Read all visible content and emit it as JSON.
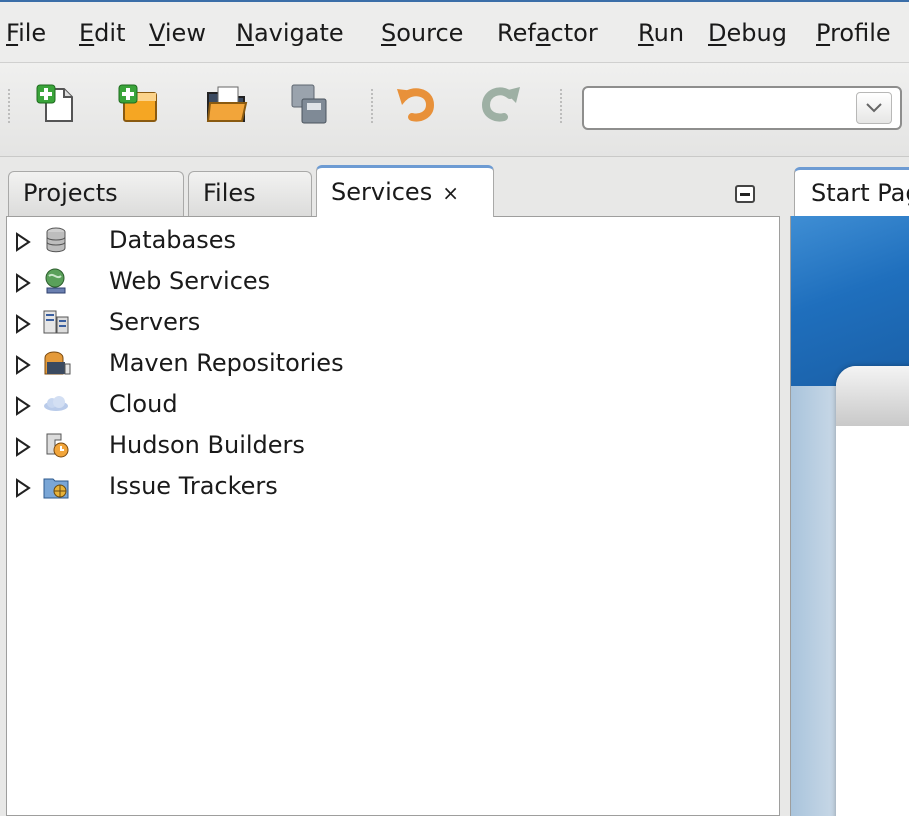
{
  "menubar": {
    "items": [
      {
        "pre": "",
        "u": "F",
        "post": "ile"
      },
      {
        "pre": "",
        "u": "E",
        "post": "dit"
      },
      {
        "pre": "",
        "u": "V",
        "post": "iew"
      },
      {
        "pre": "",
        "u": "N",
        "post": "avigate"
      },
      {
        "pre": "",
        "u": "S",
        "post": "ource"
      },
      {
        "pre": "Ref",
        "u": "a",
        "post": "ctor"
      },
      {
        "pre": "",
        "u": "R",
        "post": "un"
      },
      {
        "pre": "",
        "u": "D",
        "post": "ebug"
      },
      {
        "pre": "",
        "u": "P",
        "post": "rofile"
      }
    ]
  },
  "toolbar": {
    "icons": [
      "new-file-icon",
      "new-project-icon",
      "open-project-icon",
      "save-all-icon",
      "undo-icon",
      "redo-icon"
    ],
    "config_combo_value": ""
  },
  "left_panel": {
    "tabs": [
      {
        "label": "Projects"
      },
      {
        "label": "Files"
      },
      {
        "label": "Services",
        "close": "×"
      }
    ],
    "tree": [
      {
        "label": "Databases",
        "icon": "database-icon"
      },
      {
        "label": "Web Services",
        "icon": "web-services-icon"
      },
      {
        "label": "Servers",
        "icon": "servers-icon"
      },
      {
        "label": "Maven Repositories",
        "icon": "maven-icon"
      },
      {
        "label": "Cloud",
        "icon": "cloud-icon"
      },
      {
        "label": "Hudson Builders",
        "icon": "hudson-icon"
      },
      {
        "label": "Issue Trackers",
        "icon": "issue-tracker-icon"
      }
    ]
  },
  "right_panel": {
    "tab_label": "Start Page"
  },
  "colors": {
    "accent": "#6d9bd3",
    "start_page_blue": "#1f6fbd"
  }
}
